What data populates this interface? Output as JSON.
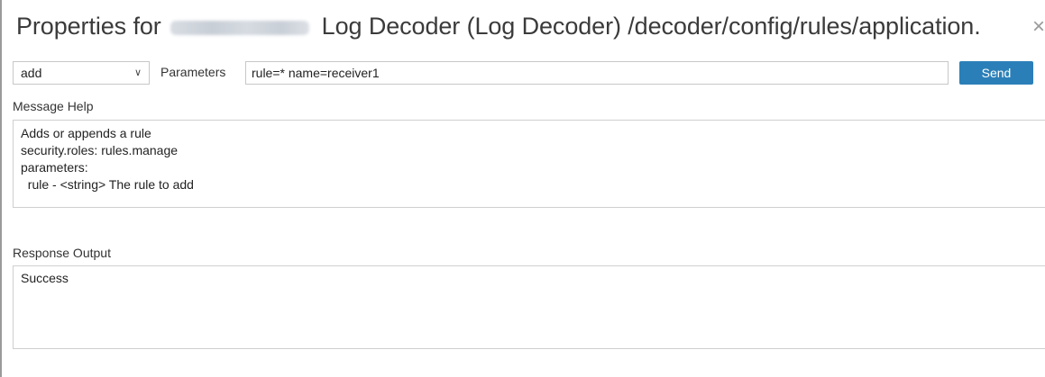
{
  "dialog": {
    "title_prefix": "Properties for",
    "title_suffix": "Log Decoder (Log Decoder) /decoder/config/rules/application.",
    "close_glyph": "×"
  },
  "toolbar": {
    "message_select_value": "add",
    "parameters_label": "Parameters",
    "parameters_value": "rule=* name=receiver1",
    "send_label": "Send"
  },
  "help": {
    "label": "Message Help",
    "lines": [
      "Adds or appends a rule",
      "security.roles: rules.manage",
      "parameters:",
      "  rule - <string> The rule to add"
    ]
  },
  "response": {
    "label": "Response Output",
    "text": "Success"
  },
  "colors": {
    "send_button": "#2b7fb8",
    "border": "#cfcfcf"
  }
}
